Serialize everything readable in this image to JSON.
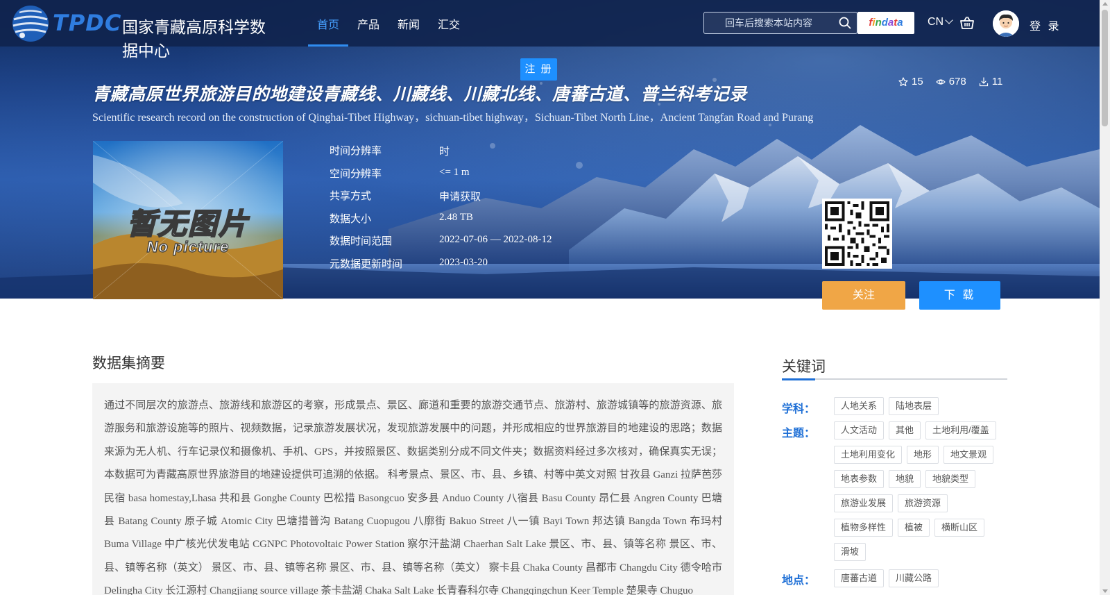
{
  "header": {
    "logo_abbr": "TPDC",
    "logo_name": "国家青藏高原科学数据中心",
    "nav": [
      {
        "label": "首页",
        "active": true
      },
      {
        "label": "产品",
        "active": false
      },
      {
        "label": "新闻",
        "active": false
      },
      {
        "label": "汇交",
        "active": false
      }
    ],
    "search_placeholder": "回车后搜索本站内容",
    "findata_letters": [
      "f",
      "i",
      "n",
      "d",
      "a",
      "t",
      "a"
    ],
    "lang_label": "CN",
    "login_label": "登 录",
    "icons": {
      "search": "search-icon",
      "cart": "basket-icon",
      "avatar": "user-avatar",
      "lang": "chevron-down-icon"
    }
  },
  "register_label": "注 册",
  "dataset": {
    "title_cn": "青藏高原世界旅游目的地建设青藏线、川藏线、川藏北线、唐蕃古道、普兰科考记录",
    "title_en": "Scientific research record on the construction of Qinghai-Tibet Highway，sichuan-tibet highway，Sichuan-Tibet North Line，Ancient Tangfan Road and Purang",
    "stats": {
      "stars": "15",
      "views": "678",
      "downloads": "11"
    },
    "thumbnail": {
      "text_cn": "暂无图片",
      "text_en": "No picture"
    },
    "metadata": [
      {
        "label": "时间分辨率",
        "value": "时"
      },
      {
        "label": "空间分辨率",
        "value": "<= 1 m"
      },
      {
        "label": "共享方式",
        "value": "申请获取"
      },
      {
        "label": "数据大小",
        "value": "2.48 TB"
      },
      {
        "label": "数据时间范围",
        "value": "2022-07-06 — 2022-08-12"
      },
      {
        "label": "元数据更新时间",
        "value": "2023-03-20"
      }
    ],
    "follow_label": "关注",
    "download_label": "下 载"
  },
  "abstract": {
    "title": "数据集摘要",
    "text": "通过不同层次的旅游点、旅游线和旅游区的考察，形成景点、景区、廊道和重要的旅游交通节点、旅游村、旅游城镇等的旅游资源、旅游服务和旅游设施等的照片、视频数据，记录旅游发展状况，发现旅游发展中的问题，并形成相应的世界旅游目的地建设的思路；数据来源为无人机、行车记录仪和摄像机、手机、GPS，并按照景区、数据类别分成不同文件夹；数据资料经过多次核对，确保真实无误；本数据可为青藏高原世界旅游目的地建设提供可追溯的依据。 科考景点、景区、市、县、乡镇、村等中英文对照 甘孜县 Ganzi 拉萨芭莎民宿 basa homestay,Lhasa 共和县 Gonghe County 巴松措 Basongcuo 安多县 Anduo County 八宿县 Basu County 昂仁县 Angren County 巴塘县 Batang County 原子城 Atomic City 巴塘措普沟 Batang Cuopugou 八廓街 Bakuo Street 八一镇 Bayi Town 邦达镇 Bangda Town 布玛村 Buma Village 中广核光伏发电站 CGNPC Photovoltaic Power Station 察尔汗盐湖 Chaerhan Salt Lake 景区、市、县、镇等名称 景区、市、县、镇等名称（英文） 景区、市、县、镇等名称 景区、市、县、镇等名称（英文） 察卡县 Chaka County 昌都市 Changdu City 德令哈市 Delingha City 长江源村 Changjiang source village 茶卡盐湖 Chaka Salt Lake 长青春科尔寺 Changqingchun Keer Temple 楚果寺 Chuguo"
  },
  "keywords": {
    "title": "关键词",
    "groups": [
      {
        "label": "学科：",
        "tags": [
          "人地关系",
          "陆地表层"
        ]
      },
      {
        "label": "主题：",
        "tags": [
          "人文活动",
          "其他",
          "土地利用/覆盖",
          "土地利用变化",
          "地形",
          "地文景观",
          "地表参数",
          "地貌",
          "地貌类型",
          "旅游业发展",
          "旅游资源",
          "植物多样性",
          "植被",
          "横断山区",
          "滑坡"
        ]
      },
      {
        "label": "地点：",
        "tags": [
          "唐蕃古道",
          "川藏公路"
        ]
      }
    ]
  },
  "colors": {
    "accent": "#1e90ff",
    "follow": "#f0a646",
    "keyword_label": "#1e6fd6"
  }
}
